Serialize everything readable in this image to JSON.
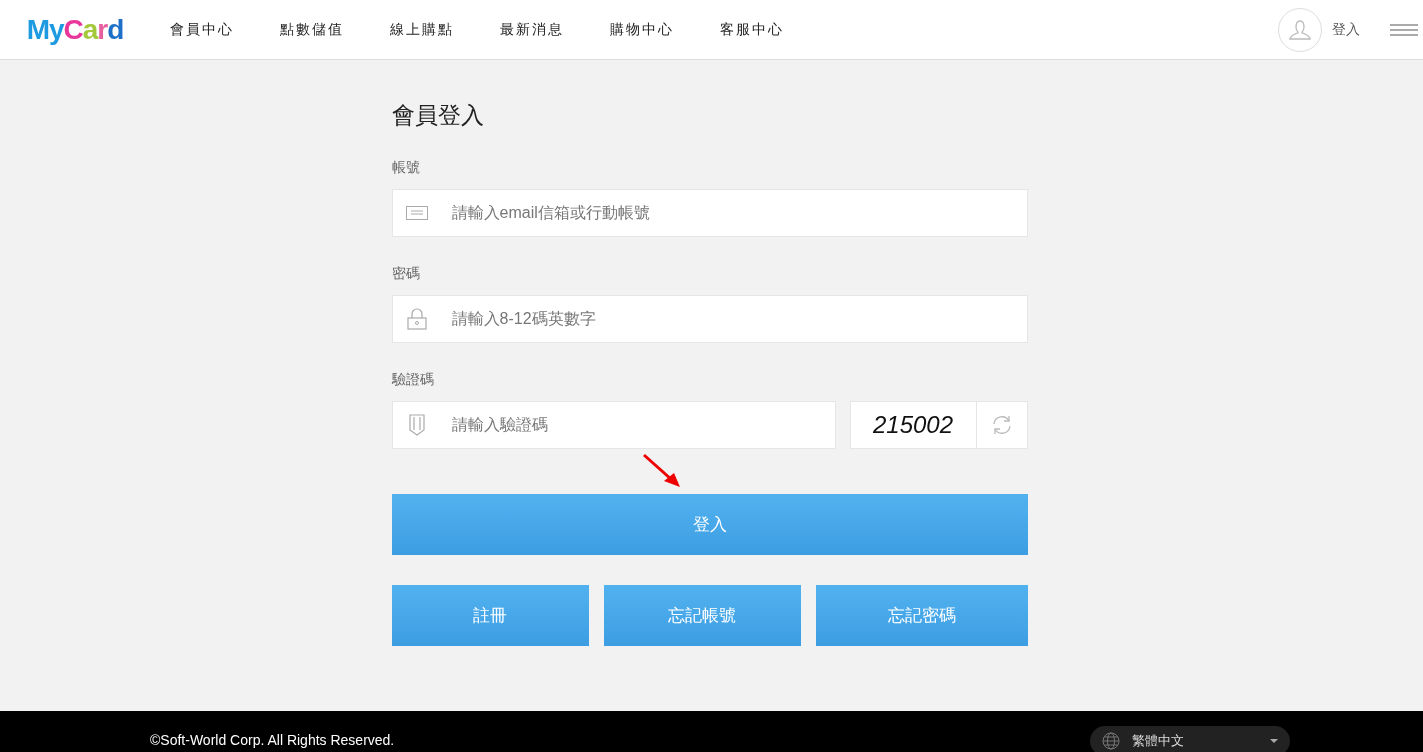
{
  "header": {
    "logo": "MyCard",
    "nav": [
      {
        "label": "會員中心"
      },
      {
        "label": "點數儲值"
      },
      {
        "label": "線上購點"
      },
      {
        "label": "最新消息"
      },
      {
        "label": "購物中心"
      },
      {
        "label": "客服中心"
      }
    ],
    "login": "登入"
  },
  "form": {
    "title": "會員登入",
    "fields": [
      {
        "kind": "account",
        "label": "帳號",
        "placeholder": "請輸入email信箱或行動帳號"
      },
      {
        "kind": "password",
        "label": "密碼",
        "placeholder": "請輸入8-12碼英數字"
      },
      {
        "kind": "captcha",
        "label": "驗證碼",
        "placeholder": "請輸入驗證碼",
        "code": "215002"
      }
    ],
    "submit": "登入",
    "links": [
      "註冊",
      "忘記帳號",
      "忘記密碼"
    ]
  },
  "footer": {
    "copyright": "©Soft-World Corp. All Rights Reserved.",
    "language": "繁體中文"
  }
}
